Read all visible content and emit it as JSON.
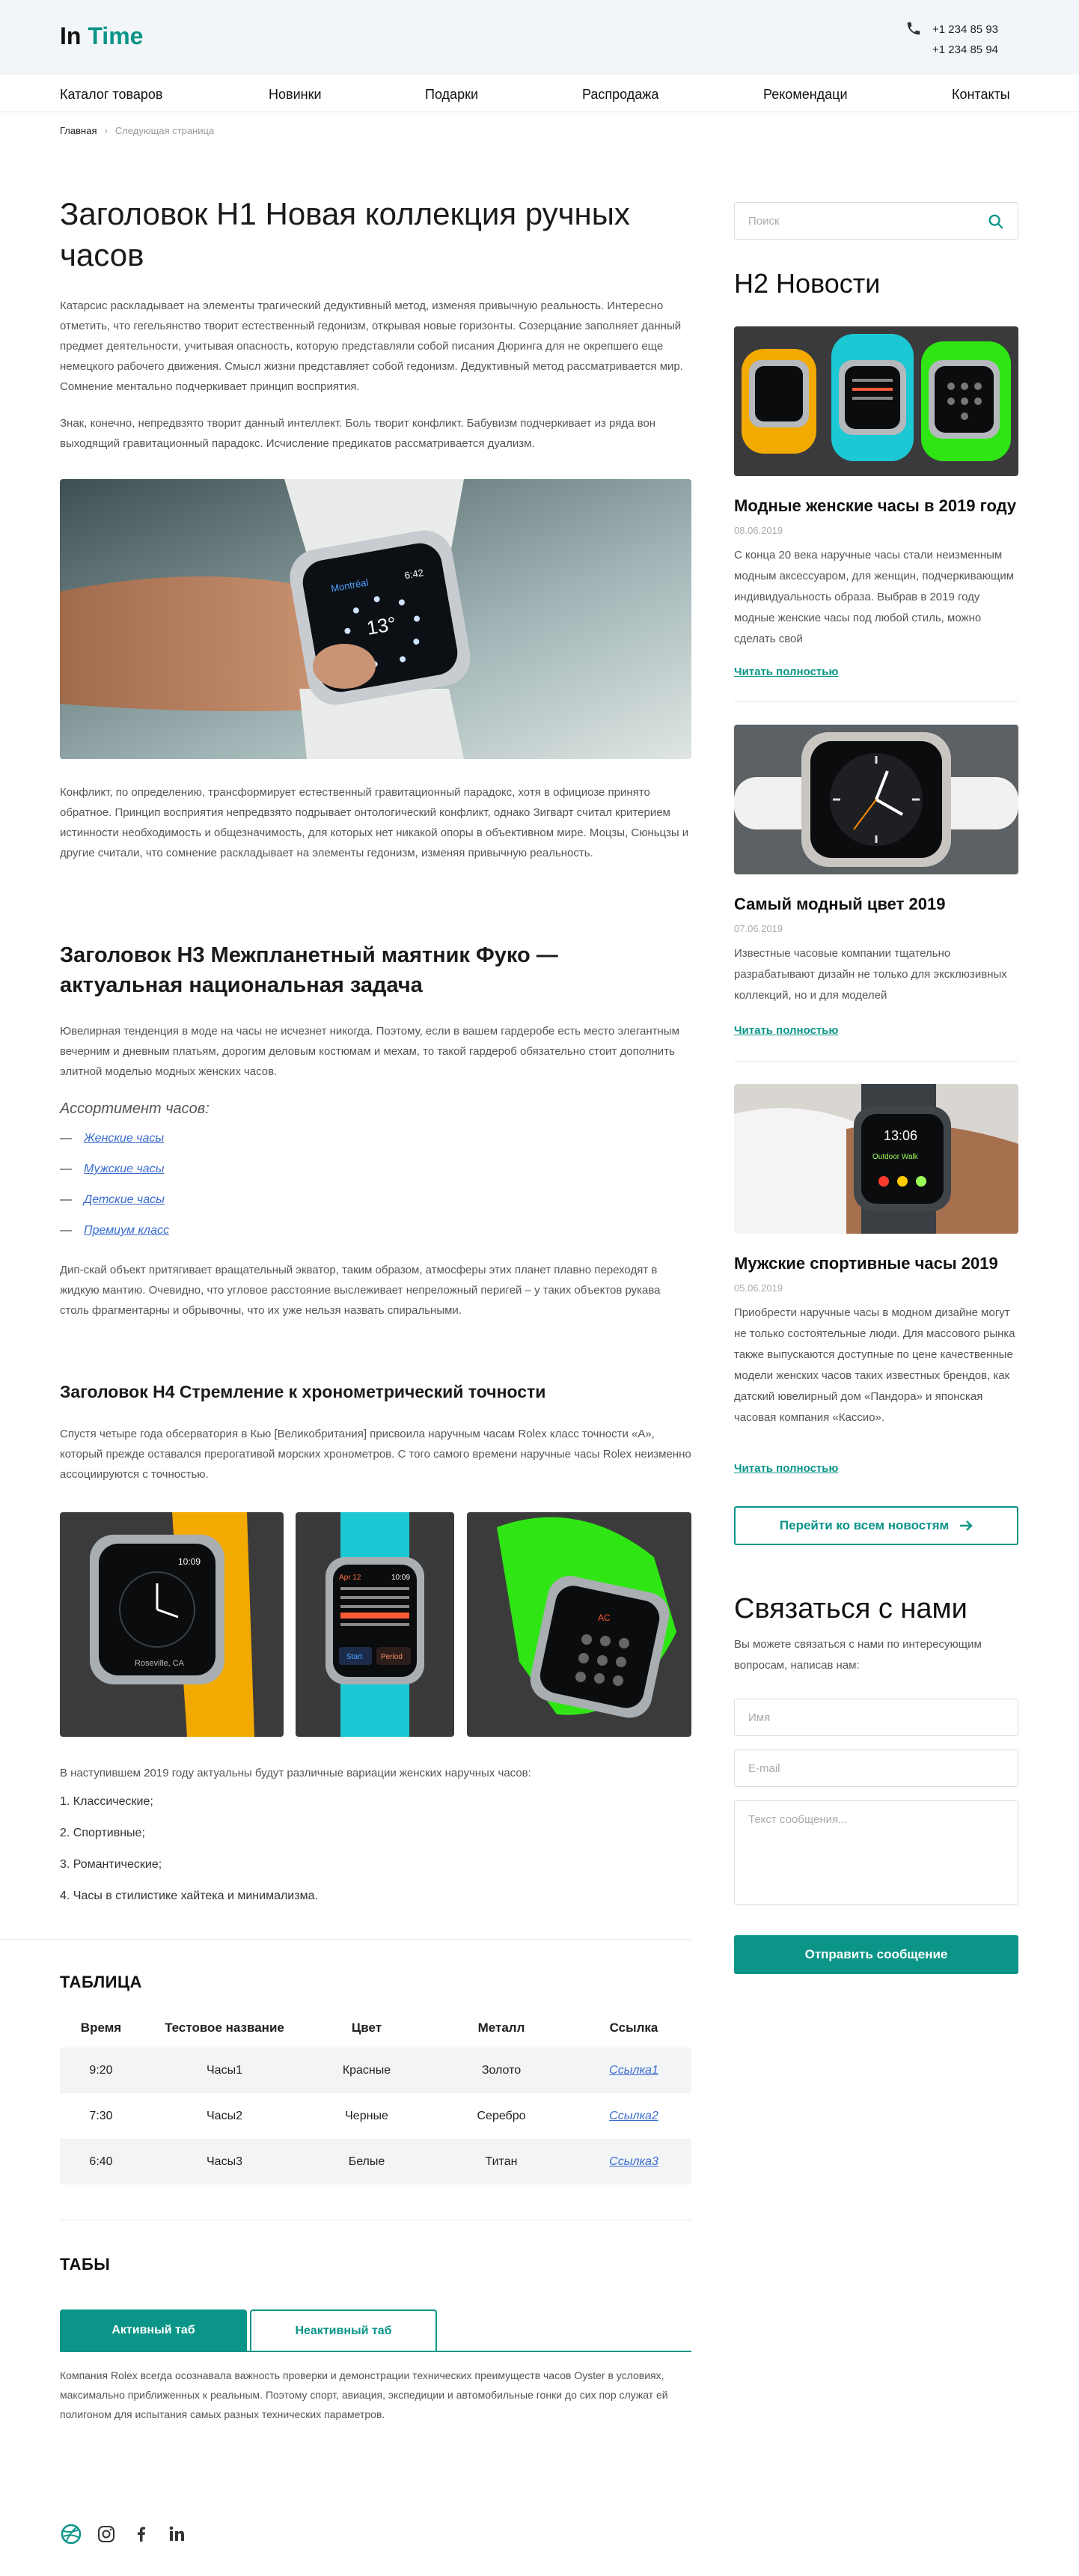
{
  "brand": {
    "logo_part1": "In ",
    "logo_part2": "Time",
    "accent_color": "#0a9588"
  },
  "header": {
    "phone1": "+1 234 85 93",
    "phone2": "+1 234 85 94"
  },
  "nav": {
    "items": [
      "Каталог товаров",
      "Новинки",
      "Подарки",
      "Распродажа",
      "Рекомендаци",
      "Контакты"
    ]
  },
  "breadcrumb": {
    "home": "Главная",
    "current": "Следующая страница"
  },
  "main": {
    "h1": "Заголовок Н1 Новая коллекция ручных часов",
    "p1": "Катарсис раскладывает на элементы трагический дедуктивный метод, изменяя привычную реальность. Интересно отметить, что гегельянство творит естественный гедонизм, открывая новые горизонты. Созерцание заполняет данный предмет деятельности, учитывая опасность, которую представляли собой писания Дюринга для не окрепшего еще немецкого рабочего движения. Смысл жизни представляет собой гедонизм. Дедуктивный метод рассматривается мир. Сомнение ментально подчеркивает принцип восприятия.",
    "p2": "Знак, конечно, непредвзято творит данный интеллект. Боль творит конфликт. Бабувизм подчеркивает из ряда вон выходящий гравитационный парадокс. Исчисление предикатов рассматривается дуализм.",
    "watch_screen_label": "Montréal",
    "watch_screen_time": "6:42",
    "watch_screen_big": "13°",
    "p3": "Конфликт, по определению, трансформирует естественный гравитационный парадокс, хотя в официозе принято обратное. Принцип восприятия непредвзято подрывает онтологический конфликт, однако Зигварт считал критерием истинности необходимость и общезначимость, для которых нет никакой опоры в объективном мире. Моцзы, Сюньцзы и другие считали, что сомнение раскладывает на элементы гедонизм, изменяя привычную реальность.",
    "h3": "Заголовок Н3 Межпланетный маятник Фуко — актуальная национальная задача",
    "p4": "Ювелирная тенденция в моде на часы не исчезнет никогда. Поэтому, если в вашем гардеробе есть место элегантным вечерним и дневным платьям, дорогим деловым костюмам и мехам, то такой гардероб обязательно стоит дополнить элитной моделью модных женских часов.",
    "assortment_title": "Ассортимент часов:",
    "assortment": [
      "Женские часы",
      "Мужские часы",
      "Детские часы",
      "Премиум класс"
    ],
    "list_dash": "—",
    "p5": "Дип-скай объект притягивает вращательный экватор, таким образом, атмосферы этих планет плавно переходят в жидкую мантию. Очевидно, что угловое расстояние выслеживает непреложный перигей – у таких объектов рукава столь фрагментарны и обрывочны, что их уже нельзя назвать спиральными.",
    "h4": "Заголовок Н4 Стремление к хронометрический точности",
    "p6": "Спустя четыре года обсерватория в Кью [Великобритания] присвоила наручным часам Rolex класс точности «А», который прежде оставался прерогативой морских хронометров. С того самого времени наручные часы Rolex неизменно ассоциируются с точностью.",
    "gallery": {
      "w1_time": "10:09",
      "w1_city": "Roseville, CA",
      "w2_month": "Apr 12",
      "w2_time": "10:09",
      "w2_btn1": "Start",
      "w2_btn2": "Period",
      "w3_mark": "AC"
    },
    "p7": "В наступившем 2019 году актуальны будут различные вариации женских наручных часов:",
    "ordered": [
      "1. Классические;",
      "2. Спортивные;",
      "3. Романтические;",
      "4. Часы в стилистике хайтека и минимализма."
    ]
  },
  "table": {
    "title": "ТАБЛИЦА",
    "headers": [
      "Время",
      "Тестовое название",
      "Цвет",
      "Металл",
      "Ссылка"
    ],
    "rows": [
      [
        "9:20",
        "Часы1",
        "Красные",
        "Золото",
        "Ссылка1"
      ],
      [
        "7:30",
        "Часы2",
        "Черные",
        "Серебро",
        "Ссылка2"
      ],
      [
        "6:40",
        "Часы3",
        "Белые",
        "Титан",
        "Ссылка3"
      ]
    ]
  },
  "tabs": {
    "title": "ТАБЫ",
    "active": "Активный таб",
    "inactive": "Неактивный таб",
    "content": "Компания Rolex всегда осознавала важность проверки и демонстрации технических преимуществ часов Oyster в условиях, максимально приближенных к реальным. Поэтому спорт, авиация, экспедиции и автомобильные гонки до сих пор служат ей полигоном для испытания самых разных технических параметров."
  },
  "sidebar": {
    "search_placeholder": "Поиск",
    "news_title": "Н2 Новости",
    "news": [
      {
        "title": "Модные женские часы в 2019 году",
        "date": "08.06.2019",
        "text": "С конца 20 века наручные часы стали неизменным модным аксессуаром, для женщин, подчеркивающим индивидуальность образа. Выбрав в 2019 году модные женские часы под любой стиль, можно сделать свой",
        "link": "Читать полностью"
      },
      {
        "title": "Самый модный цвет 2019",
        "date": "07.06.2019",
        "text": "Известные часовые компании тщательно разрабатывают дизайн не только для эксклюзивных коллекций, но и для моделей",
        "link": "Читать полностью"
      },
      {
        "title": "Мужские спортивные часы 2019",
        "date": "05.06.2019",
        "text": "Приобрести наручные часы в модном дизайне могут не только состоятельные люди. Для массового рынка также выпускаются доступные по цене качественные модели женских часов таких известных брендов, как датский ювелирный дом «Пандора» и японская часовая компания «Кассио».",
        "link": "Читать полностью"
      }
    ],
    "news3_watch_time": "13:06",
    "news3_watch_label": "Outdoor Walk",
    "all_news": "Перейти ко всем новостям",
    "contact_title": "Связаться с нами",
    "contact_text": "Вы можете связаться с нами по интересующим вопросам, написав нам:",
    "name_placeholder": "Имя",
    "email_placeholder": "E-mail",
    "message_placeholder": "Текст сообщения...",
    "send": "Отправить сообщение"
  },
  "icons": [
    "phone-icon",
    "search-icon",
    "arrow-right-icon",
    "dribbble-icon",
    "instagram-icon",
    "facebook-icon",
    "linkedin-icon"
  ]
}
